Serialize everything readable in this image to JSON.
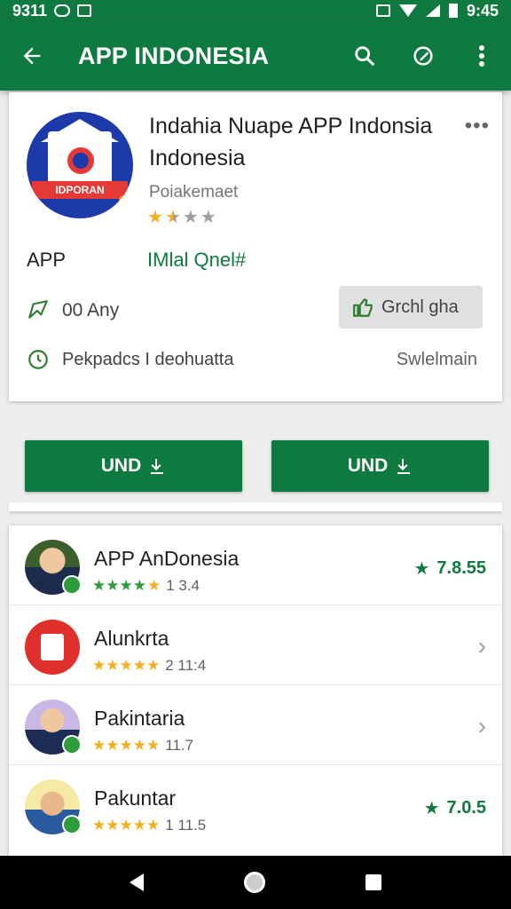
{
  "status_bar": {
    "time_left": "9311",
    "time_right": "9:45"
  },
  "app_bar": {
    "title": "APP INDONESIA",
    "icons": [
      "arrow-back-icon",
      "search-icon",
      "edit-icon",
      "more-vert-icon"
    ]
  },
  "detail": {
    "icon_banner": "IDPORAN",
    "title": "Indahia Nuape APP Indonsia Indonesia",
    "developer": "Poiakemaet",
    "rating_stars_filled": 1.5,
    "category": "APP",
    "link_text": "IMlal Qnel#",
    "row1_text": "00 Any",
    "chip_label": "Grchl gha",
    "row2_text": "Pekpadcs I deohuatta",
    "row2_right": "Swlelmain"
  },
  "buttons": {
    "primary_label": "UND",
    "secondary_label": "UND"
  },
  "list": {
    "items": [
      {
        "name": "APP AnDonesia",
        "rating_text": "1 3.4",
        "stars": 4.5,
        "score": "7.8.55",
        "trailing": "score"
      },
      {
        "name": "Alunkrta",
        "rating_text": "2 11:4",
        "stars": 4.5,
        "score": "",
        "trailing": "chevron"
      },
      {
        "name": "Pakintaria",
        "rating_text": "11.7",
        "stars": 4.5,
        "score": "",
        "trailing": "chevron"
      },
      {
        "name": "Pakuntar",
        "rating_text": "1 11.5",
        "stars": 4.5,
        "score": "7.0.5",
        "trailing": "score"
      }
    ]
  },
  "colors": {
    "primary": "#0f7a3f",
    "star": "#f2b01e",
    "background": "#ededed"
  }
}
